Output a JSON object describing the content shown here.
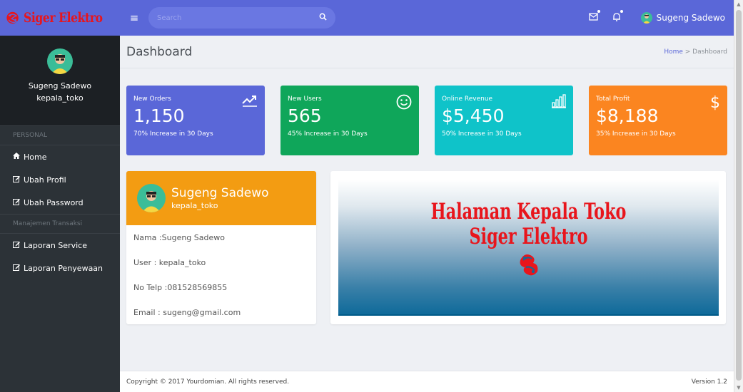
{
  "brand": {
    "name": "Siger Elektro"
  },
  "topbar": {
    "search_placeholder": "Search",
    "user_name": "Sugeng Sadewo",
    "icons": [
      "menu-icon",
      "search-icon",
      "mail-icon",
      "bell-icon"
    ]
  },
  "sidebar": {
    "user_name": "Sugeng Sadewo",
    "user_role": "kepala_toko",
    "section_personal": "PERSONAL",
    "items": [
      {
        "label": "Home",
        "icon": "home-icon"
      },
      {
        "label": "Ubah Profil",
        "icon": "edit-icon"
      },
      {
        "label": "Ubah Password",
        "icon": "edit-icon"
      }
    ],
    "section_transaksi": "Manajemen Transaksi",
    "items2": [
      {
        "label": "Laporan Service",
        "icon": "edit-icon"
      },
      {
        "label": "Laporan Penyewaan",
        "icon": "edit-icon"
      }
    ]
  },
  "page": {
    "title": "Dashboard",
    "breadcrumb_home": "Home",
    "breadcrumb_sep": " > ",
    "breadcrumb_current": "Dashboard"
  },
  "stats": [
    {
      "label": "New Orders",
      "value": "1,150",
      "sub": "70% Increase in 30 Days",
      "color": "#5a67d8",
      "icon": "trend-up-icon"
    },
    {
      "label": "New Users",
      "value": "565",
      "sub": "45% Increase in 30 Days",
      "color": "#0fa65a",
      "icon": "smile-icon"
    },
    {
      "label": "Online Revenue",
      "value": "$5,450",
      "sub": "50% Increase in 30 Days",
      "color": "#0fc3c9",
      "icon": "bar-chart-icon"
    },
    {
      "label": "Total Profit",
      "value": "$8,188",
      "sub": "35% Increase in 30 Days",
      "color": "#fb8520",
      "icon": "dollar-icon"
    }
  ],
  "profile_card": {
    "name": "Sugeng Sadewo",
    "role": "kepala_toko",
    "nama": "Nama :Sugeng Sadewo",
    "user": "User : kepala_toko",
    "telp": "No Telp :081528569855",
    "email": "Email : sugeng@gmail.com",
    "header_color": "#f39c12"
  },
  "banner": {
    "line1": "Halaman Kepala Toko",
    "line2": "Siger Elektro"
  },
  "footer": {
    "copyright": "Copyright © 2017 Yourdomian. All rights reserved.",
    "version": "Version 1.2"
  }
}
